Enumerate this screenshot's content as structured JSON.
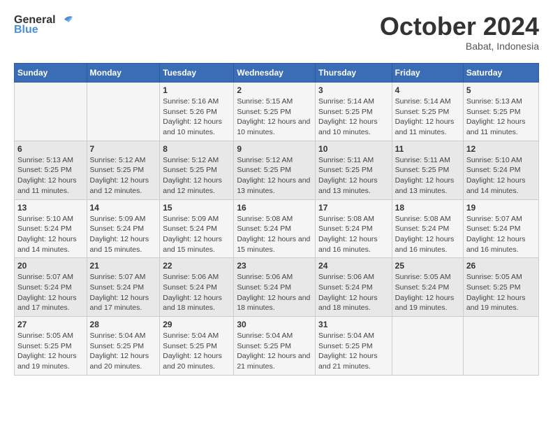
{
  "logo": {
    "line1": "General",
    "line2": "Blue"
  },
  "title": "October 2024",
  "location": "Babat, Indonesia",
  "weekdays": [
    "Sunday",
    "Monday",
    "Tuesday",
    "Wednesday",
    "Thursday",
    "Friday",
    "Saturday"
  ],
  "weeks": [
    [
      {
        "day": "",
        "sunrise": "",
        "sunset": "",
        "daylight": ""
      },
      {
        "day": "",
        "sunrise": "",
        "sunset": "",
        "daylight": ""
      },
      {
        "day": "1",
        "sunrise": "Sunrise: 5:16 AM",
        "sunset": "Sunset: 5:26 PM",
        "daylight": "Daylight: 12 hours and 10 minutes."
      },
      {
        "day": "2",
        "sunrise": "Sunrise: 5:15 AM",
        "sunset": "Sunset: 5:25 PM",
        "daylight": "Daylight: 12 hours and 10 minutes."
      },
      {
        "day": "3",
        "sunrise": "Sunrise: 5:14 AM",
        "sunset": "Sunset: 5:25 PM",
        "daylight": "Daylight: 12 hours and 10 minutes."
      },
      {
        "day": "4",
        "sunrise": "Sunrise: 5:14 AM",
        "sunset": "Sunset: 5:25 PM",
        "daylight": "Daylight: 12 hours and 11 minutes."
      },
      {
        "day": "5",
        "sunrise": "Sunrise: 5:13 AM",
        "sunset": "Sunset: 5:25 PM",
        "daylight": "Daylight: 12 hours and 11 minutes."
      }
    ],
    [
      {
        "day": "6",
        "sunrise": "Sunrise: 5:13 AM",
        "sunset": "Sunset: 5:25 PM",
        "daylight": "Daylight: 12 hours and 11 minutes."
      },
      {
        "day": "7",
        "sunrise": "Sunrise: 5:12 AM",
        "sunset": "Sunset: 5:25 PM",
        "daylight": "Daylight: 12 hours and 12 minutes."
      },
      {
        "day": "8",
        "sunrise": "Sunrise: 5:12 AM",
        "sunset": "Sunset: 5:25 PM",
        "daylight": "Daylight: 12 hours and 12 minutes."
      },
      {
        "day": "9",
        "sunrise": "Sunrise: 5:12 AM",
        "sunset": "Sunset: 5:25 PM",
        "daylight": "Daylight: 12 hours and 13 minutes."
      },
      {
        "day": "10",
        "sunrise": "Sunrise: 5:11 AM",
        "sunset": "Sunset: 5:25 PM",
        "daylight": "Daylight: 12 hours and 13 minutes."
      },
      {
        "day": "11",
        "sunrise": "Sunrise: 5:11 AM",
        "sunset": "Sunset: 5:25 PM",
        "daylight": "Daylight: 12 hours and 13 minutes."
      },
      {
        "day": "12",
        "sunrise": "Sunrise: 5:10 AM",
        "sunset": "Sunset: 5:24 PM",
        "daylight": "Daylight: 12 hours and 14 minutes."
      }
    ],
    [
      {
        "day": "13",
        "sunrise": "Sunrise: 5:10 AM",
        "sunset": "Sunset: 5:24 PM",
        "daylight": "Daylight: 12 hours and 14 minutes."
      },
      {
        "day": "14",
        "sunrise": "Sunrise: 5:09 AM",
        "sunset": "Sunset: 5:24 PM",
        "daylight": "Daylight: 12 hours and 15 minutes."
      },
      {
        "day": "15",
        "sunrise": "Sunrise: 5:09 AM",
        "sunset": "Sunset: 5:24 PM",
        "daylight": "Daylight: 12 hours and 15 minutes."
      },
      {
        "day": "16",
        "sunrise": "Sunrise: 5:08 AM",
        "sunset": "Sunset: 5:24 PM",
        "daylight": "Daylight: 12 hours and 15 minutes."
      },
      {
        "day": "17",
        "sunrise": "Sunrise: 5:08 AM",
        "sunset": "Sunset: 5:24 PM",
        "daylight": "Daylight: 12 hours and 16 minutes."
      },
      {
        "day": "18",
        "sunrise": "Sunrise: 5:08 AM",
        "sunset": "Sunset: 5:24 PM",
        "daylight": "Daylight: 12 hours and 16 minutes."
      },
      {
        "day": "19",
        "sunrise": "Sunrise: 5:07 AM",
        "sunset": "Sunset: 5:24 PM",
        "daylight": "Daylight: 12 hours and 16 minutes."
      }
    ],
    [
      {
        "day": "20",
        "sunrise": "Sunrise: 5:07 AM",
        "sunset": "Sunset: 5:24 PM",
        "daylight": "Daylight: 12 hours and 17 minutes."
      },
      {
        "day": "21",
        "sunrise": "Sunrise: 5:07 AM",
        "sunset": "Sunset: 5:24 PM",
        "daylight": "Daylight: 12 hours and 17 minutes."
      },
      {
        "day": "22",
        "sunrise": "Sunrise: 5:06 AM",
        "sunset": "Sunset: 5:24 PM",
        "daylight": "Daylight: 12 hours and 18 minutes."
      },
      {
        "day": "23",
        "sunrise": "Sunrise: 5:06 AM",
        "sunset": "Sunset: 5:24 PM",
        "daylight": "Daylight: 12 hours and 18 minutes."
      },
      {
        "day": "24",
        "sunrise": "Sunrise: 5:06 AM",
        "sunset": "Sunset: 5:24 PM",
        "daylight": "Daylight: 12 hours and 18 minutes."
      },
      {
        "day": "25",
        "sunrise": "Sunrise: 5:05 AM",
        "sunset": "Sunset: 5:24 PM",
        "daylight": "Daylight: 12 hours and 19 minutes."
      },
      {
        "day": "26",
        "sunrise": "Sunrise: 5:05 AM",
        "sunset": "Sunset: 5:25 PM",
        "daylight": "Daylight: 12 hours and 19 minutes."
      }
    ],
    [
      {
        "day": "27",
        "sunrise": "Sunrise: 5:05 AM",
        "sunset": "Sunset: 5:25 PM",
        "daylight": "Daylight: 12 hours and 19 minutes."
      },
      {
        "day": "28",
        "sunrise": "Sunrise: 5:04 AM",
        "sunset": "Sunset: 5:25 PM",
        "daylight": "Daylight: 12 hours and 20 minutes."
      },
      {
        "day": "29",
        "sunrise": "Sunrise: 5:04 AM",
        "sunset": "Sunset: 5:25 PM",
        "daylight": "Daylight: 12 hours and 20 minutes."
      },
      {
        "day": "30",
        "sunrise": "Sunrise: 5:04 AM",
        "sunset": "Sunset: 5:25 PM",
        "daylight": "Daylight: 12 hours and 21 minutes."
      },
      {
        "day": "31",
        "sunrise": "Sunrise: 5:04 AM",
        "sunset": "Sunset: 5:25 PM",
        "daylight": "Daylight: 12 hours and 21 minutes."
      },
      {
        "day": "",
        "sunrise": "",
        "sunset": "",
        "daylight": ""
      },
      {
        "day": "",
        "sunrise": "",
        "sunset": "",
        "daylight": ""
      }
    ]
  ]
}
